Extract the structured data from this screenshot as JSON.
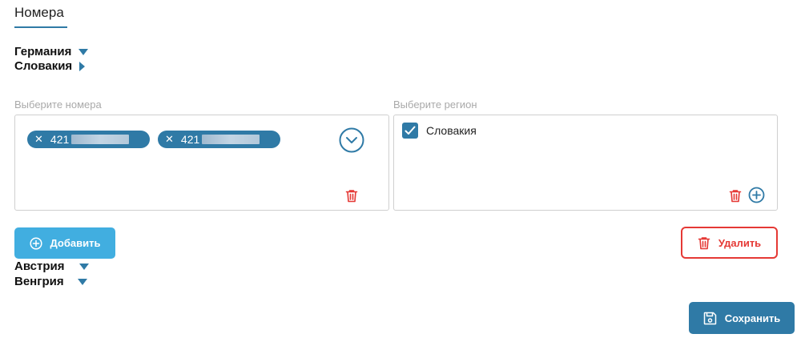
{
  "tab": {
    "label": "Номера"
  },
  "countries": {
    "germany": "Германия",
    "slovakia": "Словакия",
    "austria": "Австрия",
    "hungary": "Венгрия"
  },
  "numbers_field": {
    "label": "Выберите номера",
    "chips": [
      {
        "value": "421",
        "remove": "✕"
      },
      {
        "value": "421",
        "remove": "✕"
      }
    ]
  },
  "region_field": {
    "label": "Выберите регион",
    "selected": "Словакия",
    "checked": true
  },
  "actions": {
    "add": "Добавить",
    "delete": "Удалить",
    "save": "Сохранить"
  },
  "colors": {
    "primary": "#2f7aa6",
    "add_button": "#41aee0",
    "danger": "#e53935"
  }
}
